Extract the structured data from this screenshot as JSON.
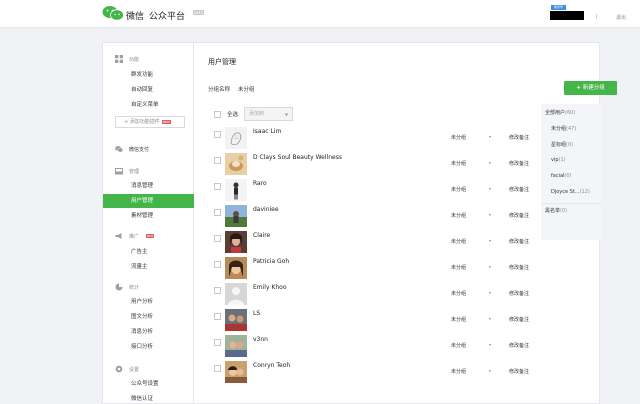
{
  "header": {
    "brand": "微信",
    "platform": "公众平台",
    "beta": "beta",
    "account_badge": "服务号",
    "separator": "|",
    "exit": "退出"
  },
  "sidebar": {
    "features": {
      "label": "功能",
      "icon": "grid-icon",
      "items": [
        "群发功能",
        "自动回复",
        "自定义菜单"
      ]
    },
    "add_plugin": {
      "label": "+ 添加功能插件",
      "badge": "NEW"
    },
    "wechat_pay": {
      "label": "微信支付",
      "icon": "wallet-icon"
    },
    "management": {
      "label": "管理",
      "icon": "inbox-icon",
      "items": [
        "消息管理",
        "用户管理",
        "素材管理"
      ],
      "active_index": 1
    },
    "promotion": {
      "label": "推广",
      "icon": "megaphone-icon",
      "badge": "HOT",
      "items": [
        "广告主",
        "流量主"
      ]
    },
    "statistics": {
      "label": "统计",
      "icon": "chart-pie-icon",
      "items": [
        "用户分析",
        "图文分析",
        "消息分析",
        "接口分析"
      ]
    },
    "settings": {
      "label": "设置",
      "icon": "gear-icon",
      "items": [
        "公众号设置",
        "微信认证"
      ]
    }
  },
  "main": {
    "title": "用户管理",
    "group_label": "分组名称",
    "group_value": "未分组",
    "new_group_button": "新建分组",
    "select_all": "全选",
    "add_to_placeholder": "添加到",
    "remark_label": "修改备注",
    "default_group": "未分组",
    "users": [
      {
        "name": "Isaac Lim",
        "avatar": "sketch"
      },
      {
        "name": "D Clays Soul Beauty Wellness",
        "avatar": "pottery"
      },
      {
        "name": "Raro",
        "avatar": "person"
      },
      {
        "name": "daviniee",
        "avatar": "outdoor"
      },
      {
        "name": "Claire",
        "avatar": "portrait"
      },
      {
        "name": "Patricia Goh",
        "avatar": "selfie"
      },
      {
        "name": "Emily Khoo",
        "avatar": "default"
      },
      {
        "name": "LS",
        "avatar": "group"
      },
      {
        "name": "v3nn",
        "avatar": "group2"
      },
      {
        "name": "Conryn Teoh",
        "avatar": "couple"
      }
    ]
  },
  "group_panel": {
    "all_users": {
      "label": "全部用户",
      "count": "(60)"
    },
    "groups": [
      {
        "label": "未分组",
        "count": "(47)"
      },
      {
        "label": "星标组",
        "count": "(0)"
      },
      {
        "label": "vip",
        "count": "(1)"
      },
      {
        "label": "facial",
        "count": "(0)"
      },
      {
        "label": "Djoyce St...",
        "count": "(12)"
      }
    ],
    "blacklist": {
      "label": "黑名单",
      "count": "(0)"
    }
  },
  "colors": {
    "accent_green": "#44b549",
    "link_blue": "#3d8ce6",
    "badge_red": "#e15f63"
  }
}
